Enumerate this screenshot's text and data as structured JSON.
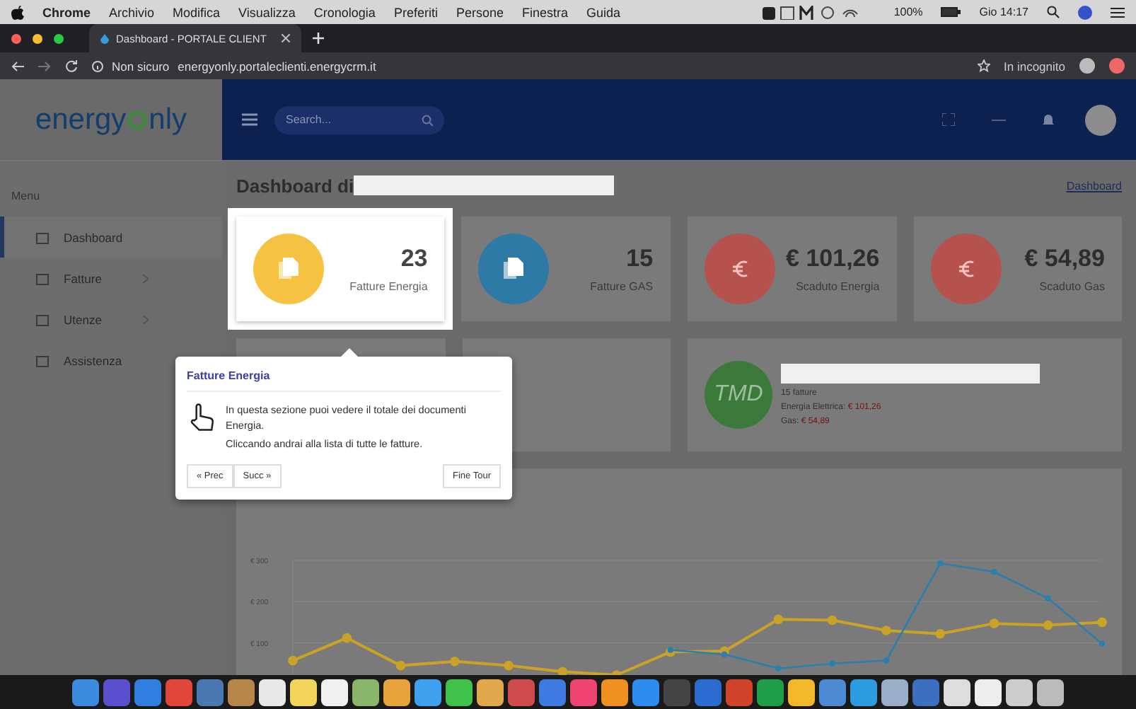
{
  "menu_bar": {
    "items": [
      "Chrome",
      "Archivio",
      "Modifica",
      "Visualizza",
      "Cronologia",
      "Preferiti",
      "Persone",
      "Finestra",
      "Guida"
    ],
    "battery": "100%",
    "clock": "Gio 14:17"
  },
  "browser": {
    "tab_title": "Dashboard - PORTALE CLIENT",
    "security": "Non sicuro",
    "url": "energyonly.portaleclienti.energycrm.it",
    "profile": "In incognito"
  },
  "header": {
    "logo_parts": [
      "energy",
      "nly"
    ],
    "search": {
      "placeholder": "Search..."
    }
  },
  "sidebar": {
    "heading": "Menu",
    "items": [
      {
        "label": "Dashboard",
        "selected": true,
        "expandable": false
      },
      {
        "label": "Fatture",
        "selected": false,
        "expandable": true
      },
      {
        "label": "Utenze",
        "selected": false,
        "expandable": true
      },
      {
        "label": "Assistenza",
        "selected": false,
        "expandable": false
      }
    ]
  },
  "page": {
    "title": "Dashboard di",
    "breadcrumb": "Dashboard"
  },
  "stats": [
    {
      "kind": "document",
      "value": "23",
      "label": "Fatture Energia",
      "color": "#f5c242",
      "highlighted": true
    },
    {
      "kind": "document",
      "value": "15",
      "label": "Fatture GAS",
      "color": "#2d7aa6",
      "highlighted": false
    },
    {
      "kind": "euro",
      "value": "€ 101,26",
      "label": "Scaduto Energia",
      "color": "#b5524d",
      "highlighted": false
    },
    {
      "kind": "euro",
      "value": "€ 54,89",
      "label": "Scaduto Gas",
      "color": "#b5524d",
      "highlighted": false
    }
  ],
  "summary": {
    "badge": "TMD",
    "count": "15 fatture",
    "lines": [
      {
        "label": "Energia Elettrica:",
        "amount": "€ 101,26"
      },
      {
        "label": "Gas:",
        "amount": "€ 54,89"
      }
    ]
  },
  "tour": {
    "title": "Fatture Energia",
    "paragraphs": [
      "In questa sezione puoi vedere il totale dei documenti Energia.",
      "Cliccando andrai alla lista di tutte le fatture."
    ],
    "prev": "« Prec",
    "next": "Succ »",
    "end": "Fine Tour"
  },
  "chart": {
    "chart_data": {
      "type": "line",
      "grid": true,
      "ylim": [
        22,
        300
      ],
      "yticks": [
        {
          "value": 100,
          "label": "€ 100"
        },
        {
          "value": 200,
          "label": "€ 200"
        },
        {
          "value": 300,
          "label": "€ 300"
        }
      ],
      "series": [
        {
          "color": "#c9a227",
          "marker": "circle",
          "values": [
            57,
            112,
            45,
            55,
            45,
            30,
            22,
            78,
            80,
            157,
            155,
            130,
            122,
            147,
            143,
            150
          ]
        },
        {
          "color": "#2b7fae",
          "marker": "circle",
          "values": [
            null,
            null,
            null,
            null,
            null,
            null,
            null,
            83,
            72,
            38,
            50,
            57,
            293,
            272,
            208,
            98
          ]
        }
      ]
    }
  }
}
